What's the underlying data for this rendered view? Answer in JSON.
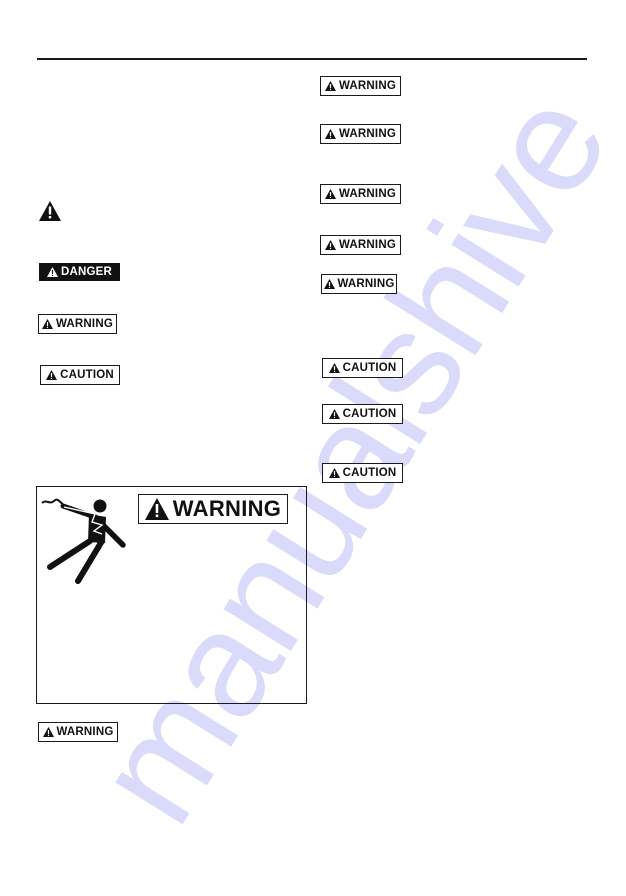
{
  "page": {
    "background": "#ffffff",
    "rule_color": "#1a1a1a"
  },
  "left_column": {
    "alert_icon": "warning-triangle-icon",
    "labels": [
      {
        "type": "danger",
        "text": "DANGER",
        "icon": "warning-triangle-icon"
      },
      {
        "type": "warning",
        "text": "WARNING",
        "icon": "warning-triangle-icon"
      },
      {
        "type": "caution",
        "text": "CAUTION",
        "icon": "warning-triangle-icon"
      }
    ],
    "shock_box": {
      "icon": "electrocution-hazard-icon",
      "label": {
        "type": "warning",
        "text": "WARNING",
        "icon": "warning-triangle-icon"
      }
    },
    "bottom_label": {
      "type": "warning",
      "text": "WARNING",
      "icon": "warning-triangle-icon"
    }
  },
  "right_column": {
    "labels": [
      {
        "type": "warning",
        "text": "WARNING"
      },
      {
        "type": "warning",
        "text": "WARNING"
      },
      {
        "type": "warning",
        "text": "WARNING"
      },
      {
        "type": "warning",
        "text": "WARNING"
      },
      {
        "type": "warning",
        "text": "WARNING"
      },
      {
        "type": "caution",
        "text": "CAUTION"
      },
      {
        "type": "caution",
        "text": "CAUTION"
      },
      {
        "type": "caution",
        "text": "CAUTION"
      }
    ]
  },
  "watermark": {
    "text": "manualshive",
    "color": "#9696f0"
  }
}
